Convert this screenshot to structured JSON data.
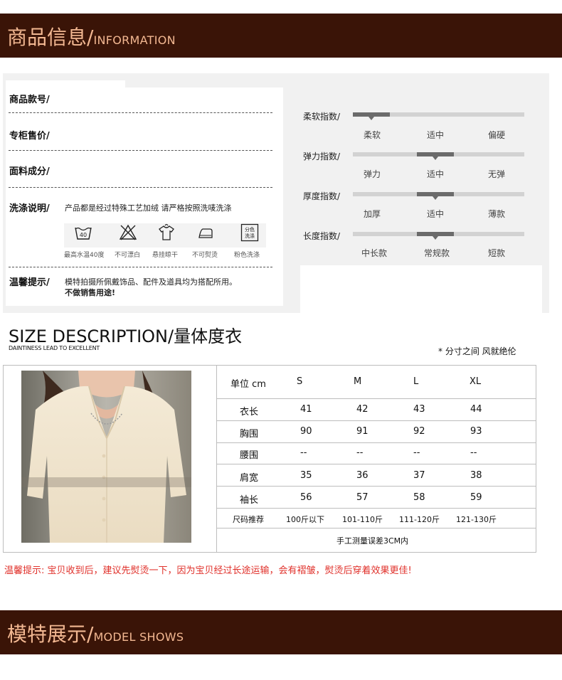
{
  "info_banner": {
    "cn": "商品信息/",
    "en": "INFORMATION"
  },
  "info_left": {
    "rows": [
      {
        "label": "商品款号/",
        "value": ""
      },
      {
        "label": "专柜售价/",
        "value": ""
      },
      {
        "label": "面料成分/",
        "value": ""
      }
    ],
    "wash": {
      "label": "洗涤说明/",
      "text": "产品都是经过特殊工艺加绒 请严格按照洗唛洗涤",
      "icons": [
        {
          "icon": "wash-40-icon",
          "caption": "最高水温40度",
          "badge": "40"
        },
        {
          "icon": "no-bleach-icon",
          "caption": "不可漂白"
        },
        {
          "icon": "hang-dry-icon",
          "caption": "悬挂晾干"
        },
        {
          "icon": "no-iron-icon",
          "caption": "不可熨烫"
        },
        {
          "icon": "separate-wash-icon",
          "caption": "粉色洗涤",
          "badge_line1": "分色",
          "badge_line2": "洗涤"
        }
      ]
    },
    "tips": {
      "label": "温馨提示/",
      "line1": "模特拍摄所佩戴饰品、配件及道具均为搭配所用。",
      "line2": "不做销售用途!"
    }
  },
  "info_right": {
    "scales": [
      {
        "label": "柔软指数/",
        "options": [
          "柔软",
          "适中",
          "偏硬"
        ],
        "selected": 0
      },
      {
        "label": "弹力指数/",
        "options": [
          "弹力",
          "适中",
          "无弹"
        ],
        "selected": 1
      },
      {
        "label": "厚度指数/",
        "options": [
          "加厚",
          "适中",
          "薄款"
        ],
        "selected": 1
      },
      {
        "label": "长度指数/",
        "options": [
          "中长款",
          "常规款",
          "短款"
        ],
        "selected": 1
      }
    ]
  },
  "size": {
    "title": "SIZE DESCRIPTION/量体度衣",
    "subtitle": "DAINTINESS LEAD TO EXCELLENT",
    "note": "* 分寸之间 风就绝伦",
    "header": [
      "单位 cm",
      "S",
      "M",
      "L",
      "XL"
    ],
    "rows": [
      {
        "name": "衣长",
        "values": [
          "41",
          "42",
          "43",
          "44"
        ]
      },
      {
        "name": "胸围",
        "values": [
          "90",
          "91",
          "92",
          "93"
        ]
      },
      {
        "name": "腰围",
        "values": [
          "--",
          "--",
          "--",
          "--"
        ]
      },
      {
        "name": "肩宽",
        "values": [
          "35",
          "36",
          "37",
          "38"
        ]
      },
      {
        "name": "袖长",
        "values": [
          "56",
          "57",
          "58",
          "59"
        ]
      }
    ],
    "recommend": {
      "name": "尺码推荐",
      "values": [
        "100斤以下",
        "101-110斤",
        "111-120斤",
        "121-130斤"
      ]
    },
    "footer": "手工测量误差3CM内"
  },
  "warm_tip": "温馨提示: 宝贝收到后，建议先熨烫一下，因为宝贝经过长途运输，会有褶皱，熨烫后穿着效果更佳!",
  "model_banner": {
    "cn": "模特展示/",
    "en": "MODEL SHOWS"
  }
}
